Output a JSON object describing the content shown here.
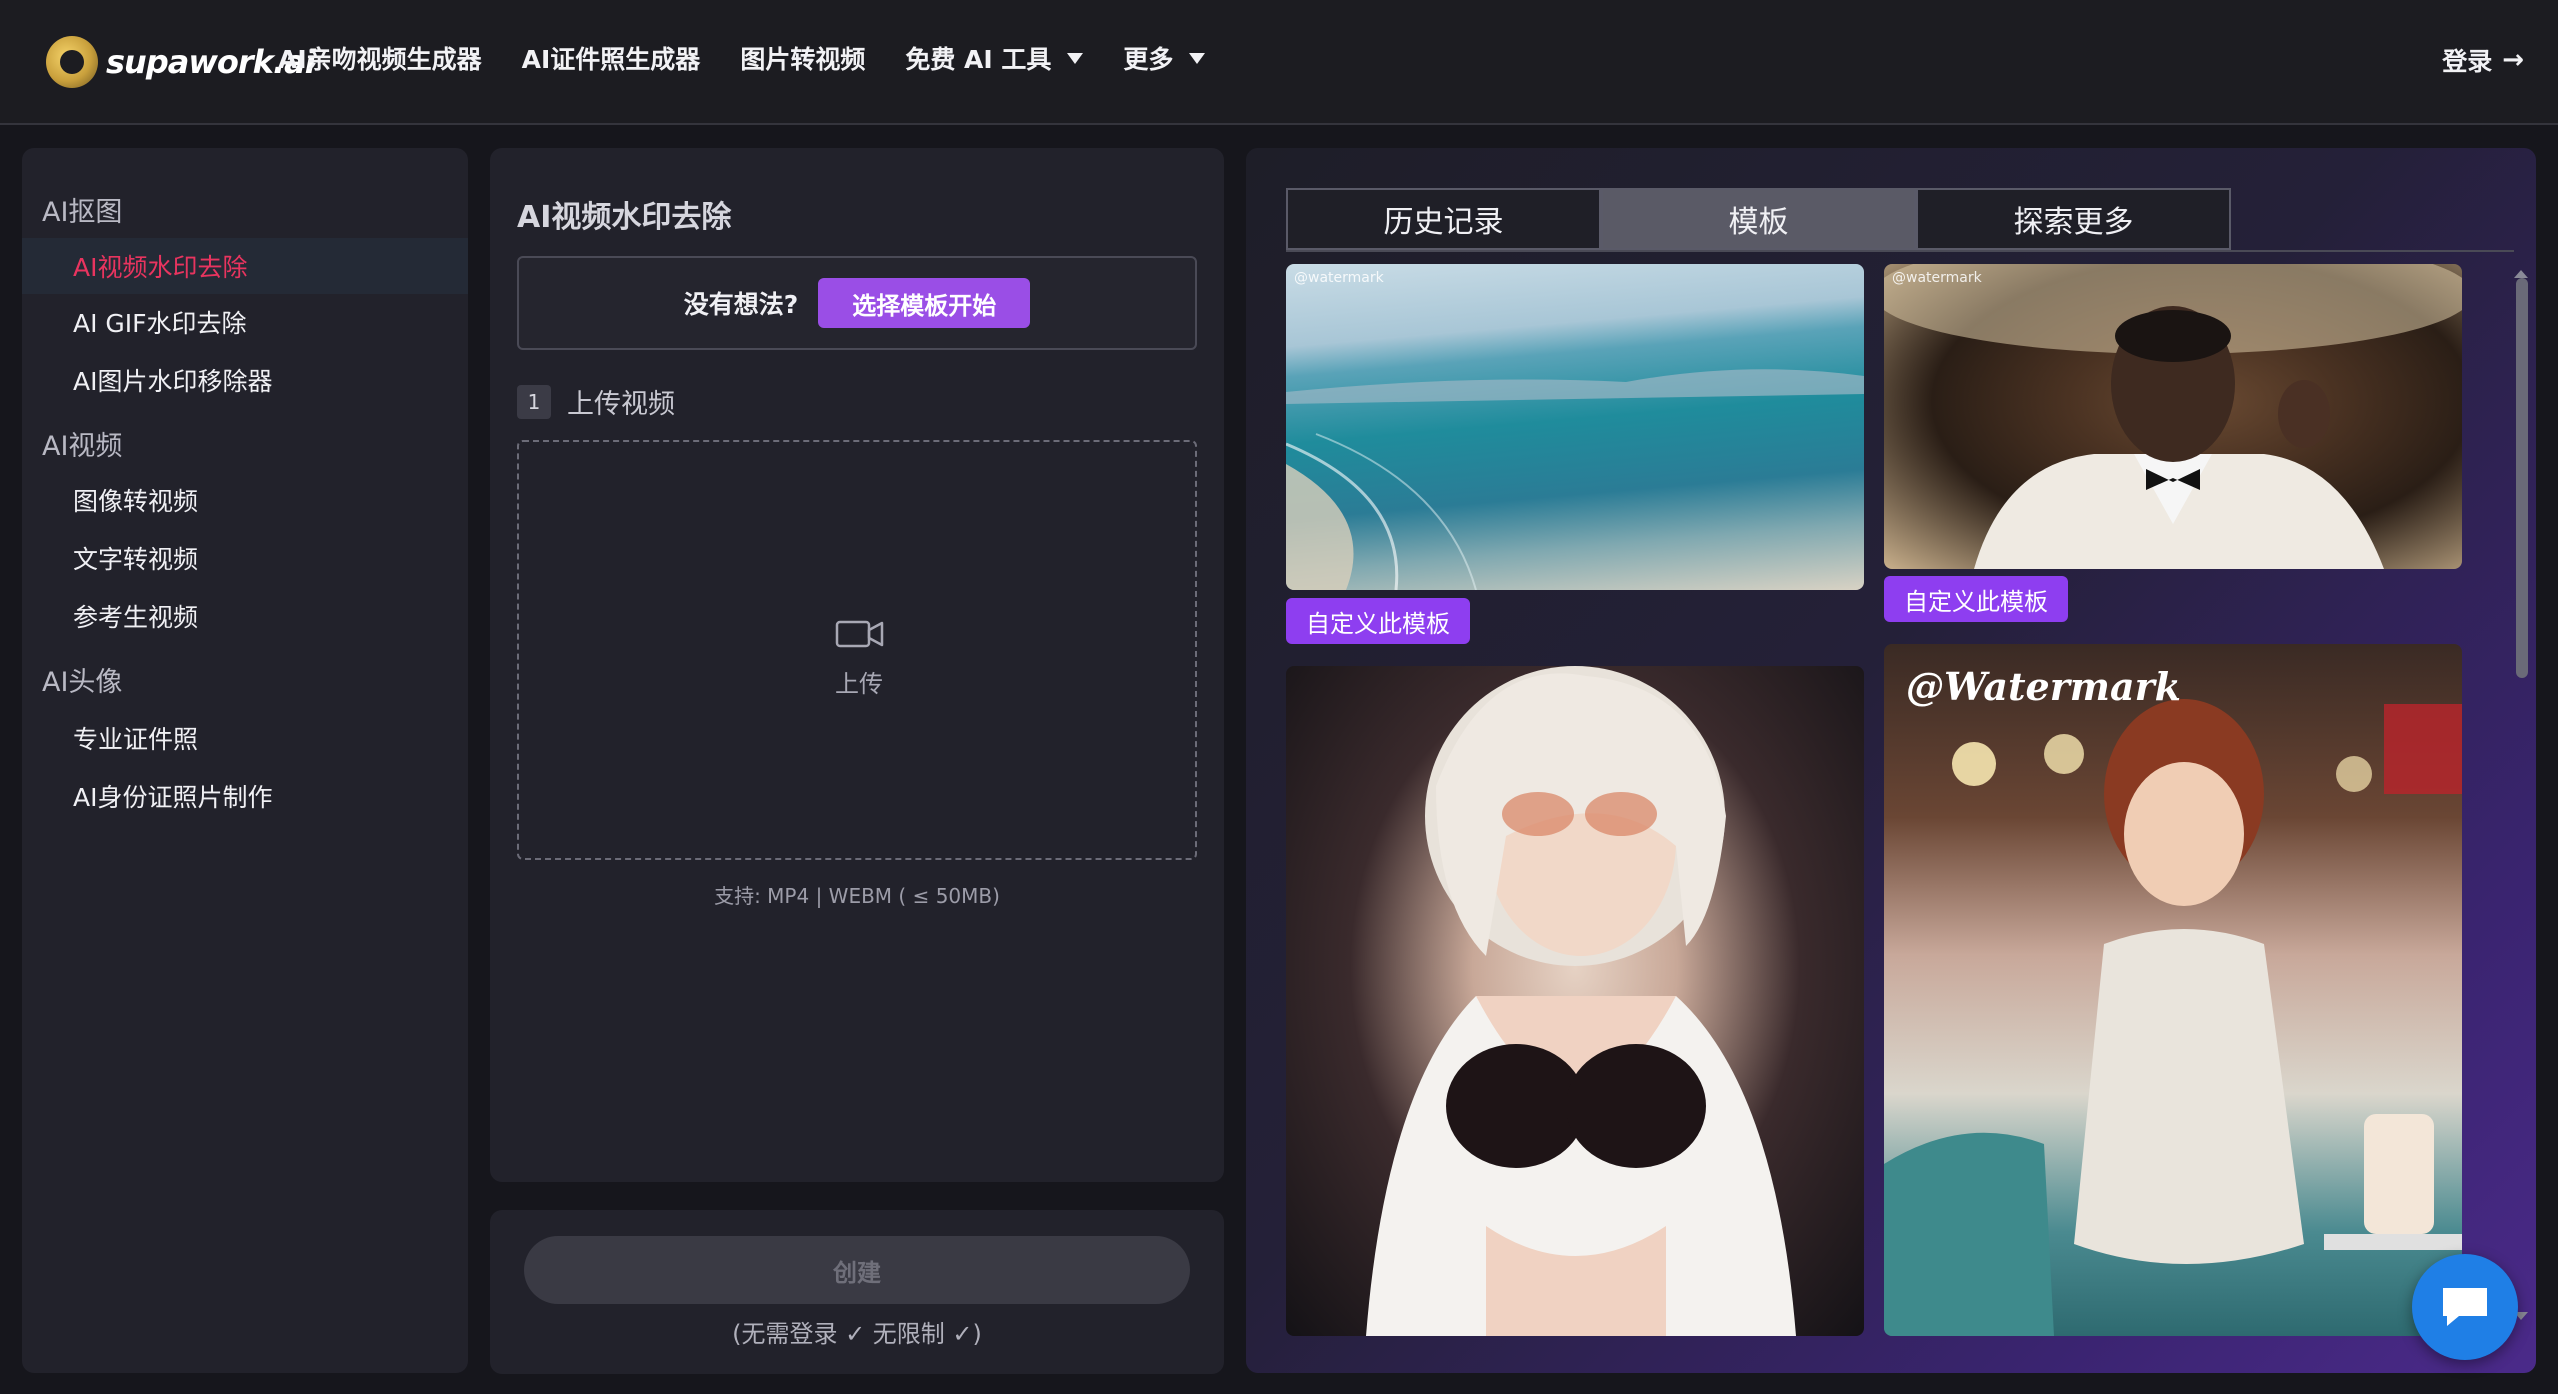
{
  "header": {
    "logo_text": "supawork.ai",
    "nav": [
      {
        "label": "AI亲吻视频生成器"
      },
      {
        "label": "AI证件照生成器"
      },
      {
        "label": "图片转视频"
      },
      {
        "label": "免费 AI 工具"
      },
      {
        "label": "更多"
      }
    ],
    "login_label": "登录",
    "login_arrow": "→"
  },
  "sidebar": {
    "groups": [
      {
        "label": "AI抠图"
      },
      {
        "label": "AI视频"
      },
      {
        "label": "AI头像"
      }
    ],
    "items": [
      {
        "label": "AI视频水印去除",
        "active": true
      },
      {
        "label": "AI GIF水印去除"
      },
      {
        "label": "AI图片水印移除器"
      },
      {
        "label": "图像转视频"
      },
      {
        "label": "文字转视频"
      },
      {
        "label": "参考生视频"
      },
      {
        "label": "专业证件照"
      },
      {
        "label": "AI身份证照片制作"
      }
    ]
  },
  "main": {
    "title": "AI视频水印去除",
    "idea_label": "没有想法?",
    "idea_button": "选择模板开始",
    "step_number": "1",
    "step_label": "上传视频",
    "upload_label": "上传",
    "support_text": "支持: MP4 | WEBM ( ≤ 50MB)",
    "create_button": "创建",
    "create_note": "(无需登录 ✓ 无限制 ✓)"
  },
  "right": {
    "tabs": [
      {
        "label": "历史记录"
      },
      {
        "label": "模板",
        "active": true
      },
      {
        "label": "探索更多"
      }
    ],
    "cards": [
      {
        "watermark": "@watermark",
        "button": "自定义此模板"
      },
      {
        "watermark": "@watermark",
        "button": "自定义此模板"
      },
      {
        "watermark": ""
      },
      {
        "watermark": "@Watermark"
      }
    ]
  },
  "colors": {
    "accent_purple": "#9a4ee6",
    "active_red": "#e8345f",
    "chat_blue": "#1f7fe6"
  }
}
